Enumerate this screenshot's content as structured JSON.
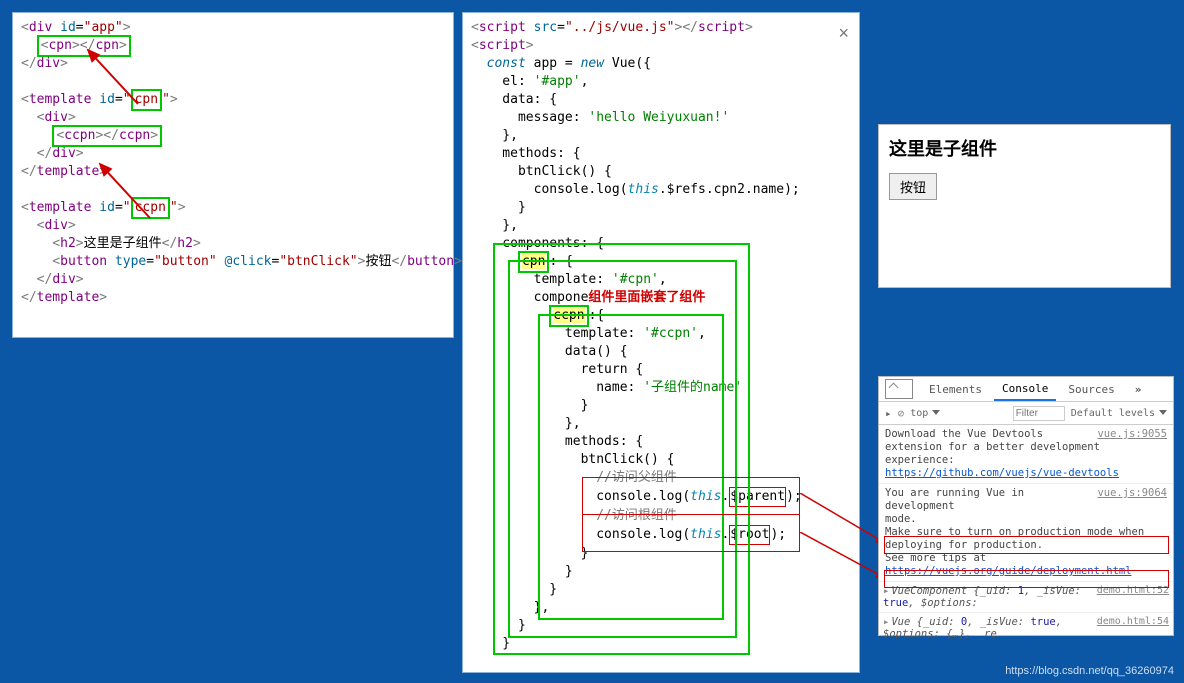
{
  "left_code": {
    "l1a": "<",
    "l1b": "div",
    "l1c": " id",
    "l1d": "=",
    "l1e": "\"app\"",
    "l1f": ">",
    "l2_open": "<",
    "l2_tag": "cpn",
    "l2_close": "></",
    "l2_tag2": "cpn",
    "l2_end": ">",
    "l3": "</",
    "l3b": "div",
    "l3c": ">",
    "l5a": "<",
    "l5b": "template",
    "l5c": " id",
    "l5d": "=",
    "l5e": "\"",
    "l5f": "cpn",
    "l5g": "\"",
    "l5h": ">",
    "l6": "  <",
    "l6b": "div",
    "l6c": ">",
    "l7o": "<",
    "l7t": "ccpn",
    "l7c": "></",
    "l7t2": "ccpn",
    "l7e": ">",
    "l8": "  </",
    "l8b": "div",
    "l8c": ">",
    "l9": "</",
    "l9b": "template",
    "l9c": ">",
    "l11a": "<",
    "l11b": "template",
    "l11c": " id",
    "l11d": "=",
    "l11e": "\"",
    "l11f": "ccpn",
    "l11g": "\"",
    "l11h": ">",
    "l12": "  <",
    "l12b": "div",
    "l12c": ">",
    "l13a": "    <",
    "l13b": "h2",
    "l13c": ">",
    "l13txt": "这里是子组件",
    "l13d": "</",
    "l13e": "h2",
    "l13f": ">",
    "l14a": "    <",
    "l14b": "button",
    "l14c": " type",
    "l14d": "=",
    "l14e": "\"button\"",
    "l14f": " @click",
    "l14g": "=",
    "l14h": "\"btnClick\"",
    "l14i": ">",
    "l14txt": "按钮",
    "l14j": "</",
    "l14k": "button",
    "l14l": ">",
    "l15": "  </",
    "l15b": "div",
    "l15c": ">",
    "l16": "</",
    "l16b": "template",
    "l16c": ">"
  },
  "mid_code": {
    "m1a": "<",
    "m1b": "script",
    "m1c": " src",
    "m1d": "=",
    "m1e": "\"../js/vue.js\"",
    "m1f": "></",
    "m1g": "script",
    "m1h": ">",
    "m2a": "<",
    "m2b": "script",
    "m2c": ">",
    "m3a": "  const",
    "m3b": " app = ",
    "m3c": "new",
    "m3d": " Vue({",
    "m4": "    el: ",
    "m4v": "'#app'",
    "m4c": ",",
    "m5": "    data: {",
    "m6": "      message: ",
    "m6v": "'hello Weiyuxuan!'",
    "m7": "    },",
    "m8": "    methods: {",
    "m9": "      btnClick() {",
    "m10": "        console.log(",
    "m10t": "this",
    "m10r": ".$refs.cpn2.name);",
    "m11": "      }",
    "m12": "    },",
    "m13": "    components: {",
    "m14": "      ",
    "m14k": "cpn",
    "m14c": ": {",
    "m15": "        template: ",
    "m15v": "'#cpn'",
    "m15c": ",",
    "m16": "        compone",
    "m16ov": "组件里面嵌套了组件",
    "m17": "          ",
    "m17k": "ccpn",
    "m17c": ":{",
    "m18": "            template: ",
    "m18v": "'#ccpn'",
    "m18c": ",",
    "m19": "            data() {",
    "m20": "              return {",
    "m21": "                name: ",
    "m21v": "'子组件的name'",
    "m22": "              }",
    "m23": "            },",
    "m24": "            methods: {",
    "m25": "              btnClick() {",
    "m26": "                ",
    "m26c": "//访问父组件",
    "m27": "                console.log(",
    "m27t": "this",
    "m27r1": ".",
    "m27r2": "$parent",
    "m27r3": ");",
    "m28": "                ",
    "m28c": "//访问根组件",
    "m29": "                console.log(",
    "m29t": "this",
    "m29r1": ".",
    "m29r2": "$root",
    "m29r3": ");",
    "m30": "              }",
    "m31": "            }",
    "m32": "          }",
    "m33": "        },",
    "m34": "      }",
    "m35": "    }"
  },
  "app": {
    "h": "这里是子组件",
    "btn": "按钮"
  },
  "dev": {
    "tabs": {
      "elements": "Elements",
      "console": "Console",
      "sources": "Sources",
      "more": "»"
    },
    "sub": {
      "top": "top",
      "filter": "Filter",
      "levels": "Default levels"
    },
    "msg1_line1": "Download the Vue Devtools",
    "msg1_side": "vue.js:9055",
    "msg1_line2": "extension for a better development experience:",
    "msg1_link": "https://github.com/vuejs/vue-devtools",
    "msg2_line1": "You are running Vue in development",
    "msg2_side": "vue.js:9064",
    "msg2_line2": "mode.",
    "msg2_line3": "Make sure to turn on production mode when deploying for production.",
    "msg2_line4": "See more tips at ",
    "msg2_link": "https://vuejs.org/guide/deployment.html",
    "row1_side": "demo.html:52",
    "row1": "VueComponent ",
    "row1b": "{_uid: ",
    "row1n": "1",
    "row1c": ", _isVue: ",
    "row1t": "true",
    "row1d": ", $options:",
    "row2_side": "demo.html:54",
    "row2": "Vue ",
    "row2b": "{_uid: ",
    "row2n": "0",
    "row2c": ", _isVue: ",
    "row2t": "true",
    "row2d": ", $options: {…}, _re"
  },
  "watermark": "https://blog.csdn.net/qq_36260974",
  "close": "×"
}
